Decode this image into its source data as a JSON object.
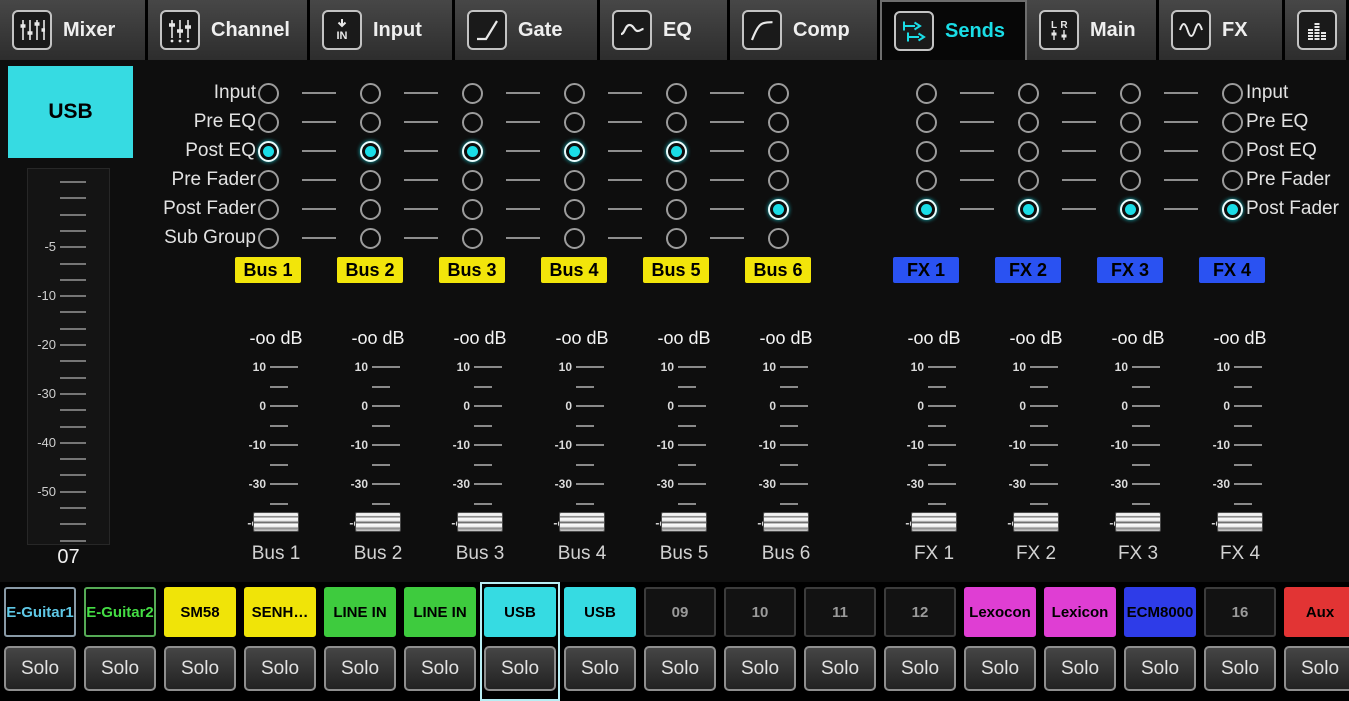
{
  "app": {
    "accent_color": "#1adde6",
    "bus_label_color": "#f2e50a",
    "fx_label_color": "#2a52f2"
  },
  "tabs": [
    {
      "label": "Mixer",
      "icon": "mixer-icon",
      "selected": false
    },
    {
      "label": "Channel",
      "icon": "channel-icon",
      "selected": false
    },
    {
      "label": "Input",
      "icon": "input-icon",
      "selected": false
    },
    {
      "label": "Gate",
      "icon": "gate-icon",
      "selected": false
    },
    {
      "label": "EQ",
      "icon": "eq-icon",
      "selected": false
    },
    {
      "label": "Comp",
      "icon": "comp-icon",
      "selected": false
    },
    {
      "label": "Sends",
      "icon": "sends-icon",
      "selected": true
    },
    {
      "label": "Main",
      "icon": "main-icon",
      "selected": false
    },
    {
      "label": "FX",
      "icon": "fx-icon",
      "selected": false
    },
    {
      "label": "",
      "icon": "meters-icon",
      "selected": false
    }
  ],
  "selected_channel": {
    "name": "USB",
    "number": "07",
    "meter_labels": [
      "-5",
      "-10",
      "-20",
      "-30",
      "-40",
      "-50"
    ]
  },
  "routing": {
    "left_rows": [
      "Input",
      "Pre EQ",
      "Post EQ",
      "Pre Fader",
      "Post Fader",
      "Sub Group"
    ],
    "right_rows": [
      "Input",
      "Pre EQ",
      "Post EQ",
      "Pre Fader",
      "Post Fader"
    ],
    "buses": [
      {
        "label": "Bus 1",
        "tap": "Post EQ"
      },
      {
        "label": "Bus 2",
        "tap": "Post EQ"
      },
      {
        "label": "Bus 3",
        "tap": "Post EQ"
      },
      {
        "label": "Bus 4",
        "tap": "Post EQ"
      },
      {
        "label": "Bus 5",
        "tap": "Post EQ"
      },
      {
        "label": "Bus 6",
        "tap": "Post Fader"
      }
    ],
    "fx": [
      {
        "label": "FX 1",
        "tap": "Post Fader"
      },
      {
        "label": "FX 2",
        "tap": "Post Fader"
      },
      {
        "label": "FX 3",
        "tap": "Post Fader"
      },
      {
        "label": "FX 4",
        "tap": "Post Fader"
      }
    ]
  },
  "sends": {
    "scale_labels": [
      "10",
      "0",
      "-10",
      "-30",
      "-oo"
    ],
    "columns": [
      {
        "label": "Bus 1",
        "value": "-oo dB",
        "group": "bus"
      },
      {
        "label": "Bus 2",
        "value": "-oo dB",
        "group": "bus"
      },
      {
        "label": "Bus 3",
        "value": "-oo dB",
        "group": "bus"
      },
      {
        "label": "Bus 4",
        "value": "-oo dB",
        "group": "bus"
      },
      {
        "label": "Bus 5",
        "value": "-oo dB",
        "group": "bus"
      },
      {
        "label": "Bus 6",
        "value": "-oo dB",
        "group": "bus"
      },
      {
        "label": "FX 1",
        "value": "-oo dB",
        "group": "fx"
      },
      {
        "label": "FX 2",
        "value": "-oo dB",
        "group": "fx"
      },
      {
        "label": "FX 3",
        "value": "-oo dB",
        "group": "fx"
      },
      {
        "label": "FX 4",
        "value": "-oo dB",
        "group": "fx"
      }
    ]
  },
  "channel_strip": {
    "solo_label": "Solo",
    "channels": [
      {
        "label": "E-Guitar1",
        "bg": "#000000",
        "fg": "#5fc8e6",
        "border": "#8899a6",
        "selected": false
      },
      {
        "label": "E-Guitar2",
        "bg": "#000000",
        "fg": "#44dd44",
        "border": "#55aa55",
        "selected": false
      },
      {
        "label": "SM58",
        "bg": "#f0e408",
        "fg": "#000000",
        "border": "#f0e408",
        "selected": false
      },
      {
        "label": "SENH…",
        "bg": "#f0e408",
        "fg": "#000000",
        "border": "#f0e408",
        "selected": false
      },
      {
        "label": "LINE IN",
        "bg": "#3ecb3e",
        "fg": "#000000",
        "border": "#3ecb3e",
        "selected": false
      },
      {
        "label": "LINE IN",
        "bg": "#3ecb3e",
        "fg": "#000000",
        "border": "#3ecb3e",
        "selected": false
      },
      {
        "label": "USB",
        "bg": "#36dbe2",
        "fg": "#000000",
        "border": "#36dbe2",
        "selected": true
      },
      {
        "label": "USB",
        "bg": "#36dbe2",
        "fg": "#000000",
        "border": "#36dbe2",
        "selected": false
      },
      {
        "label": "09",
        "bg": "#121212",
        "fg": "#9a9a9a",
        "border": "#3c3c3c",
        "selected": false
      },
      {
        "label": "10",
        "bg": "#121212",
        "fg": "#9a9a9a",
        "border": "#3c3c3c",
        "selected": false
      },
      {
        "label": "11",
        "bg": "#121212",
        "fg": "#9a9a9a",
        "border": "#3c3c3c",
        "selected": false
      },
      {
        "label": "12",
        "bg": "#121212",
        "fg": "#9a9a9a",
        "border": "#3c3c3c",
        "selected": false
      },
      {
        "label": "Lexocon",
        "bg": "#df3ed3",
        "fg": "#000000",
        "border": "#df3ed3",
        "selected": false
      },
      {
        "label": "Lexicon",
        "bg": "#df3ed3",
        "fg": "#000000",
        "border": "#df3ed3",
        "selected": false
      },
      {
        "label": "ECM8000",
        "bg": "#2e3ce8",
        "fg": "#000000",
        "border": "#2e3ce8",
        "selected": false
      },
      {
        "label": "16",
        "bg": "#121212",
        "fg": "#9a9a9a",
        "border": "#3c3c3c",
        "selected": false
      },
      {
        "label": "Aux",
        "bg": "#e23434",
        "fg": "#000000",
        "border": "#e23434",
        "selected": false
      }
    ]
  }
}
